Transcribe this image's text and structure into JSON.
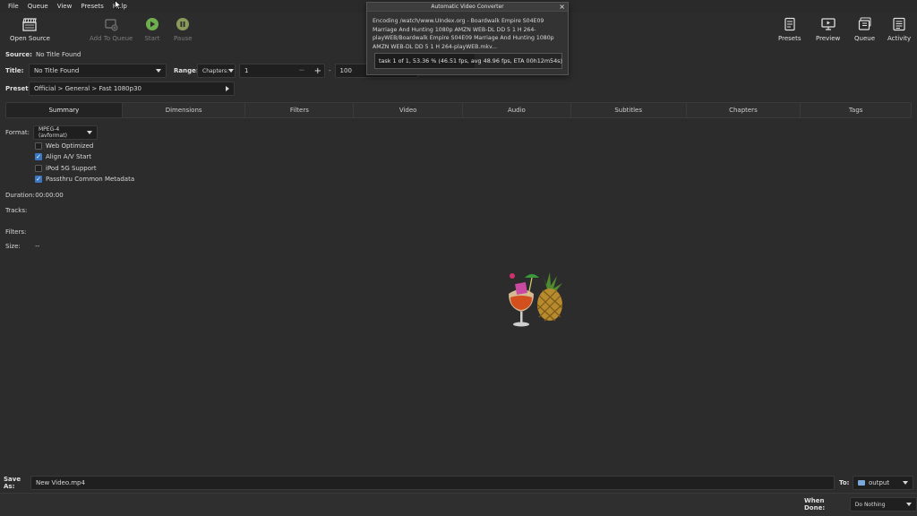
{
  "menu": [
    "File",
    "Queue",
    "View",
    "Presets",
    "Help"
  ],
  "toolbar": {
    "open_source": "Open Source",
    "add_to_queue": "Add To Queue",
    "start": "Start",
    "pause": "Pause",
    "presets": "Presets",
    "preview": "Preview",
    "queue": "Queue",
    "activity": "Activity"
  },
  "source": {
    "label": "Source:",
    "value": "No Title Found"
  },
  "title": {
    "label": "Title:",
    "value": "No Title Found"
  },
  "range": {
    "label": "Range:",
    "mode": "Chapters:",
    "start": "1",
    "dash": "-",
    "end": "100"
  },
  "preset": {
    "label": "Preset:",
    "value": "Official > General > Fast 1080p30"
  },
  "tabs": [
    "Summary",
    "Dimensions",
    "Filters",
    "Video",
    "Audio",
    "Subtitles",
    "Chapters",
    "Tags"
  ],
  "format": {
    "label": "Format:",
    "value": "MPEG-4 (avformat)"
  },
  "options": [
    {
      "label": "Web Optimized",
      "checked": false
    },
    {
      "label": "Align A/V Start",
      "checked": true
    },
    {
      "label": "iPod 5G Support",
      "checked": false
    },
    {
      "label": "Passthru Common Metadata",
      "checked": true
    }
  ],
  "summary": {
    "duration_label": "Duration:",
    "duration_value": "00:00:00",
    "tracks_label": "Tracks:",
    "filters_label": "Filters:",
    "size_label": "Size:",
    "size_value": "--"
  },
  "dialog": {
    "title": "Automatic Video Converter",
    "close": "×",
    "message": "Encoding /watch/www.UIndex.org    -    Boardwalk Empire S04E09 Marriage And Hunting 1080p AMZN WEB-DL DD 5 1 H 264-playWEB/Boardwalk Empire S04E09 Marriage And Hunting 1080p AMZN WEB-DL DD 5 1 H 264-playWEB.mkv...",
    "progress_text": "task 1 of 1, 53.36 % (46.51 fps, avg 48.96 fps, ETA 00h12m54s)",
    "progress_fraction": 0.5336
  },
  "save_as": {
    "label": "Save As:",
    "value": "New Video.mp4",
    "to_label": "To:",
    "to_value": "output"
  },
  "when_done": {
    "label": "When Done:",
    "value": "Do Nothing"
  },
  "colors": {
    "background": "#2c2c2c",
    "field": "#1f1f1f",
    "checkbox_on": "#3b78c4",
    "start_green": "#6fae4f",
    "pause_olive": "#8a9a5a"
  }
}
